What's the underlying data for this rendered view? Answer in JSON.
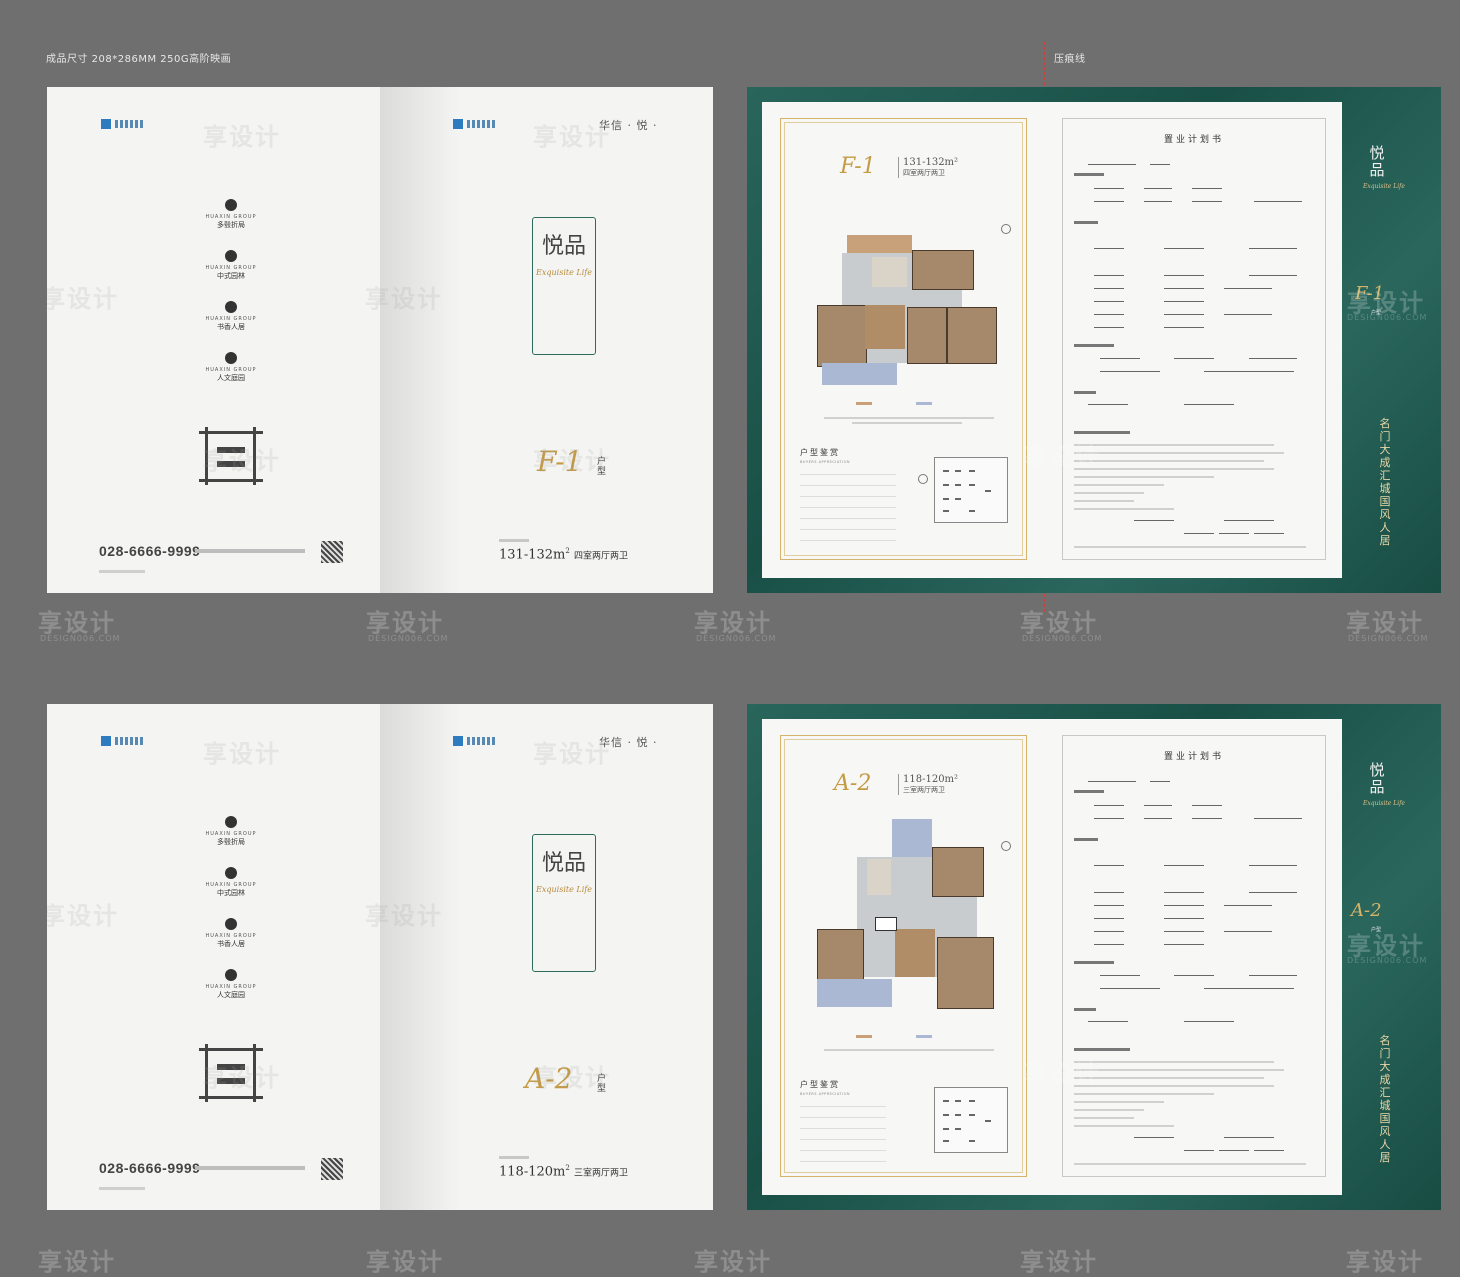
{
  "header": {
    "spec_text": "成品尺寸  208*286MM   250G高阶映画",
    "crease_label": "压痕线"
  },
  "cover": {
    "features": [
      {
        "en": "HUAXIN GROUP",
        "zh": "多毂折局"
      },
      {
        "en": "HUAXIN GROUP",
        "zh": "中式园林"
      },
      {
        "en": "HUAXIN GROUP",
        "zh": "书香人居"
      },
      {
        "en": "HUAXIN GROUP",
        "zh": "人文庭园"
      }
    ],
    "phone": "028-6666-9999",
    "brand_right": "华信 · 悦 ·",
    "yuepin": "悦品",
    "yuepin_script": "Exquisite Life"
  },
  "spreads": [
    {
      "type_code": "F-1",
      "type_label": "户型",
      "area": "131-132m²",
      "area_desc": "四室两厅两卫",
      "area_sup": "2",
      "area_main": "131-132m",
      "inner_area": "131-132m²",
      "inner_desc": "四室两厅两卫",
      "huxing_title": "户型鉴赏",
      "huxing_en": "BUYERS APPRECIATION",
      "form_title": "置业计划书",
      "side_title": "悦品",
      "side_type": "F-1",
      "side_type_label": "户型"
    },
    {
      "type_code": "A-2",
      "type_label": "户型",
      "area": "118-120m²",
      "area_desc": "三室两厅两卫",
      "area_sup": "2",
      "area_main": "118-120m",
      "inner_area": "118-120m²",
      "inner_desc": "三室两厅两卫",
      "huxing_title": "户型鉴赏",
      "huxing_en": "BUYERS APPRECIATION",
      "form_title": "置业计划书",
      "side_title": "悦品",
      "side_type": "A-2",
      "side_type_label": "户型"
    }
  ],
  "calligraphy": "名门大成汇城国风人居",
  "watermark": {
    "text": "享设计",
    "sub": "DESIGN006.COM"
  }
}
